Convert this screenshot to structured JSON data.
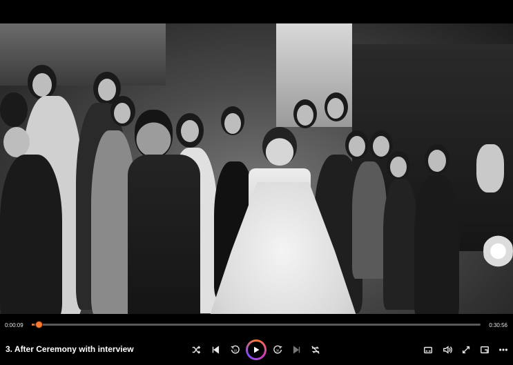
{
  "player": {
    "current_time": "0:00:09",
    "total_time": "0:30:56",
    "progress_fraction": 0.0049,
    "title": "3. After Ceremony with interview",
    "accent_color": "#ff7a2f"
  },
  "controls": {
    "left_group": [
      "shuffle-icon",
      "previous-icon",
      "rewind-10-icon",
      "play-icon",
      "forward-30-icon",
      "next-icon",
      "repeat-icon"
    ],
    "right_group": [
      "subtitles-icon",
      "volume-icon",
      "fullscreen-icon",
      "popout-icon",
      "more-icon"
    ],
    "rewind_label": "10",
    "forward_label": "30"
  }
}
